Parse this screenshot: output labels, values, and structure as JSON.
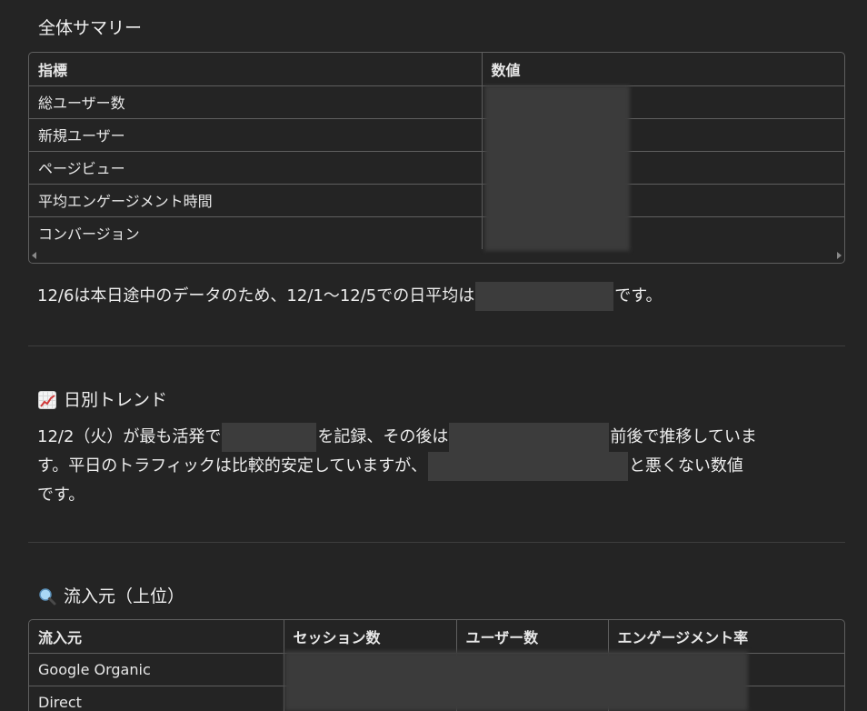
{
  "summary": {
    "title": "全体サマリー",
    "headers": [
      "指標",
      "数値"
    ],
    "rows": [
      {
        "label": "総ユーザー数"
      },
      {
        "label": "新規ユーザー"
      },
      {
        "label": "ページビュー"
      },
      {
        "label": "平均エンゲージメント時間"
      },
      {
        "label": "コンバージョン"
      }
    ],
    "note_before": "12/6は本日途中のデータのため、12/1〜12/5での日平均は",
    "note_after": "です。"
  },
  "trend": {
    "title": "日別トレンド",
    "icon": "chart-increasing-icon",
    "text1": "12/2（火）が最も活発で",
    "text2": "を記録、その後は",
    "text3": "前後で推移していま",
    "text4": "す。平日のトラフィックは比較的安定していますが、",
    "text5": "と悪くない数値",
    "text6": "です。"
  },
  "sources": {
    "title": "流入元（上位）",
    "icon": "magnifying-glass-icon",
    "headers": [
      "流入元",
      "セッション数",
      "ユーザー数",
      "エンゲージメント率"
    ],
    "rows": [
      {
        "source": "Google Organic"
      },
      {
        "source": "Direct"
      }
    ]
  }
}
